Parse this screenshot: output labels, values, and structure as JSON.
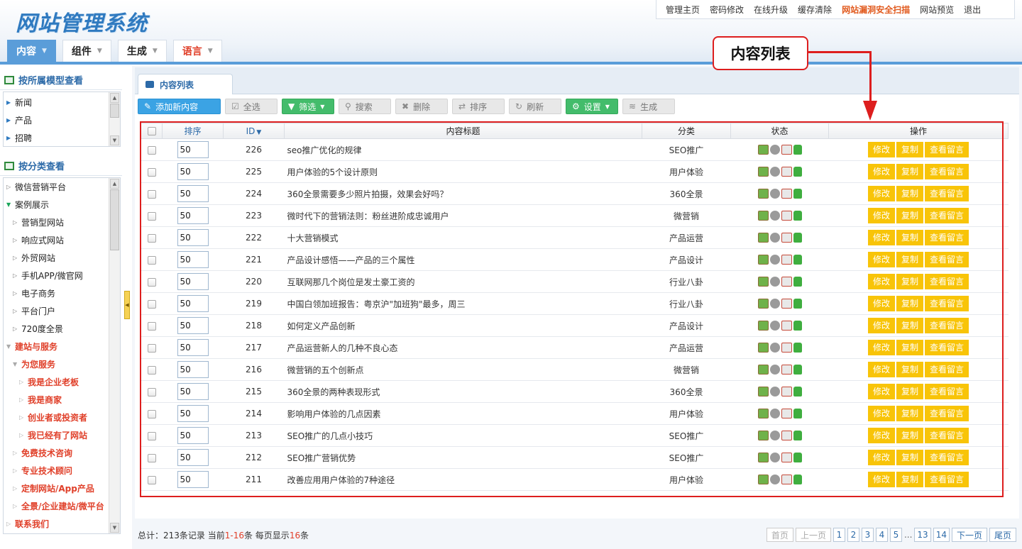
{
  "app": {
    "title": "网站管理系统"
  },
  "topnav": [
    {
      "label": "管理主页",
      "hot": false
    },
    {
      "label": "密码修改",
      "hot": false
    },
    {
      "label": "在线升级",
      "hot": false
    },
    {
      "label": "缓存清除",
      "hot": false
    },
    {
      "label": "网站漏洞安全扫描",
      "hot": true
    },
    {
      "label": "网站预览",
      "hot": false
    },
    {
      "label": "退出",
      "hot": false
    }
  ],
  "main_tabs": [
    {
      "label": "内容",
      "active": true
    },
    {
      "label": "组件",
      "active": false
    },
    {
      "label": "生成",
      "active": false
    },
    {
      "label": "语言",
      "active": false
    }
  ],
  "sidebar": {
    "model_title": "按所属模型查看",
    "model_items": [
      "新闻",
      "产品",
      "招聘"
    ],
    "category_title": "按分类查看",
    "category_items": [
      {
        "label": "微信营销平台",
        "level": 0,
        "open": false,
        "style": "normal"
      },
      {
        "label": "案例展示",
        "level": 0,
        "open": true,
        "style": "normal"
      },
      {
        "label": "营销型网站",
        "level": 1,
        "open": false,
        "style": "normal"
      },
      {
        "label": "响应式网站",
        "level": 1,
        "open": false,
        "style": "normal"
      },
      {
        "label": "外贸网站",
        "level": 1,
        "open": false,
        "style": "normal"
      },
      {
        "label": "手机APP/微官网",
        "level": 1,
        "open": false,
        "style": "normal"
      },
      {
        "label": "电子商务",
        "level": 1,
        "open": false,
        "style": "normal"
      },
      {
        "label": "平台门户",
        "level": 1,
        "open": false,
        "style": "normal"
      },
      {
        "label": "720度全景",
        "level": 1,
        "open": false,
        "style": "normal"
      },
      {
        "label": "建站与服务",
        "level": 0,
        "open": true,
        "style": "red"
      },
      {
        "label": "为您服务",
        "level": 1,
        "open": true,
        "style": "red"
      },
      {
        "label": "我是企业老板",
        "level": 2,
        "open": false,
        "style": "red"
      },
      {
        "label": "我是商家",
        "level": 2,
        "open": false,
        "style": "red"
      },
      {
        "label": "创业者或投资者",
        "level": 2,
        "open": false,
        "style": "red"
      },
      {
        "label": "我已经有了网站",
        "level": 2,
        "open": false,
        "style": "red"
      },
      {
        "label": "免费技术咨询",
        "level": 1,
        "open": false,
        "style": "red"
      },
      {
        "label": "专业技术顾问",
        "level": 1,
        "open": false,
        "style": "red"
      },
      {
        "label": "定制网站/App产品",
        "level": 1,
        "open": false,
        "style": "red"
      },
      {
        "label": "全景/企业建站/微平台",
        "level": 1,
        "open": false,
        "style": "red"
      },
      {
        "label": "联系我们",
        "level": 0,
        "open": false,
        "style": "red"
      }
    ]
  },
  "panel": {
    "tab_label": "内容列表"
  },
  "toolbar": {
    "add": "添加新内容",
    "select_all": "全选",
    "filter": "筛选",
    "search": "搜索",
    "delete": "删除",
    "sort": "排序",
    "refresh": "刷新",
    "settings": "设置",
    "generate": "生成"
  },
  "table": {
    "headers": {
      "order": "排序",
      "id": "ID",
      "title": "内容标题",
      "category": "分类",
      "status": "状态",
      "actions": "操作"
    },
    "action_labels": {
      "edit": "修改",
      "copy": "复制",
      "view": "查看留言"
    },
    "rows": [
      {
        "order": "50",
        "id": "226",
        "title": "seo推广优化的规律",
        "category": "SEO推广"
      },
      {
        "order": "50",
        "id": "225",
        "title": "用户体验的5个设计原则",
        "category": "用户体验"
      },
      {
        "order": "50",
        "id": "224",
        "title": "360全景需要多少照片拍摄，效果会好吗？",
        "category": "360全景"
      },
      {
        "order": "50",
        "id": "223",
        "title": "微时代下的营销法则：粉丝进阶成忠诚用户",
        "category": "微营销"
      },
      {
        "order": "50",
        "id": "222",
        "title": "十大营销模式",
        "category": "产品运营"
      },
      {
        "order": "50",
        "id": "221",
        "title": "产品设计感悟——产品的三个属性",
        "category": "产品设计"
      },
      {
        "order": "50",
        "id": "220",
        "title": "互联网那几个岗位是发土豪工资的",
        "category": "行业八卦"
      },
      {
        "order": "50",
        "id": "219",
        "title": "中国白领加班报告：粤京沪\"加班狗\"最多，周三",
        "category": "行业八卦"
      },
      {
        "order": "50",
        "id": "218",
        "title": "如何定义产品创新",
        "category": "产品设计"
      },
      {
        "order": "50",
        "id": "217",
        "title": "产品运营新人的几种不良心态",
        "category": "产品运营"
      },
      {
        "order": "50",
        "id": "216",
        "title": "微营销的五个创新点",
        "category": "微营销"
      },
      {
        "order": "50",
        "id": "215",
        "title": "360全景的两种表现形式",
        "category": "360全景"
      },
      {
        "order": "50",
        "id": "214",
        "title": "影响用户体验的几点因素",
        "category": "用户体验"
      },
      {
        "order": "50",
        "id": "213",
        "title": "SEO推广的几点小技巧",
        "category": "SEO推广"
      },
      {
        "order": "50",
        "id": "212",
        "title": "SEO推广营销优势",
        "category": "SEO推广"
      },
      {
        "order": "50",
        "id": "211",
        "title": "改善应用用户体验的7种途径",
        "category": "用户体验"
      }
    ]
  },
  "footer": {
    "total_prefix": "总计：",
    "total_count": "213",
    "total_mid": "条记录 当前",
    "current_range": "1-16",
    "per_page_mid": "条 每页显示",
    "per_page": "16",
    "per_page_suffix": "条",
    "pager": {
      "first": "首页",
      "prev": "上一页",
      "pages": [
        "1",
        "2",
        "3",
        "4",
        "5"
      ],
      "ellipsis": "...",
      "tail_pages": [
        "13",
        "14"
      ],
      "next": "下一页",
      "last": "尾页"
    }
  },
  "annotation": {
    "callout": "内容列表"
  },
  "colors": {
    "accent": "#5a9dd9",
    "highlight": "#e0402a",
    "action_button": "#f8c408",
    "annotation": "#dd1e1e"
  }
}
